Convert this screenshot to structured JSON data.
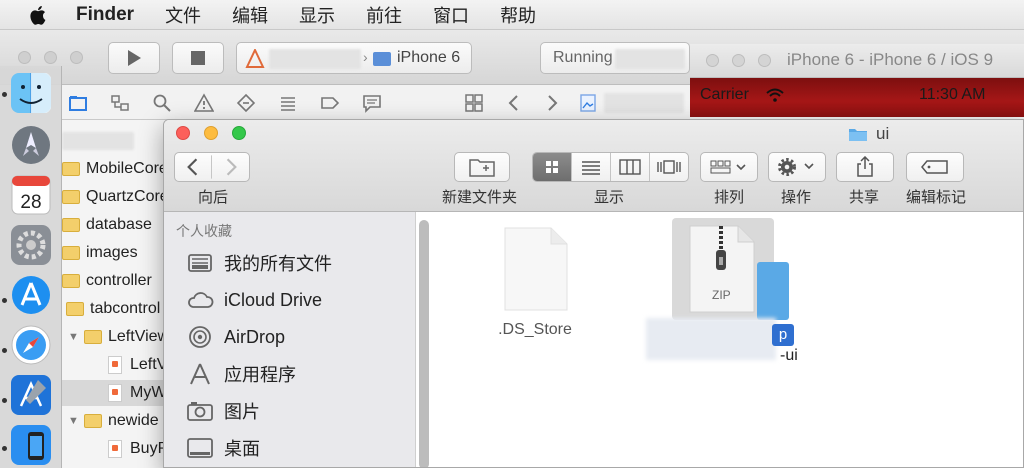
{
  "menubar": {
    "app": "Finder",
    "items": [
      "文件",
      "编辑",
      "显示",
      "前往",
      "窗口",
      "帮助"
    ]
  },
  "xcode": {
    "scheme_device": "iPhone 6",
    "status": "Running",
    "tree": [
      {
        "label": "MobileCoreS",
        "kind": "folder"
      },
      {
        "label": "QuartzCore.f",
        "kind": "folder"
      },
      {
        "label": "database",
        "kind": "folder"
      },
      {
        "label": "images",
        "kind": "folder"
      },
      {
        "label": "controller",
        "kind": "folder"
      },
      {
        "label": "tabcontrol",
        "kind": "folder"
      },
      {
        "label": "LeftView",
        "kind": "folder"
      },
      {
        "label": "LeftV",
        "kind": "swift"
      },
      {
        "label": "MyW",
        "kind": "swift"
      },
      {
        "label": "newide",
        "kind": "folder"
      },
      {
        "label": "BuyP",
        "kind": "swift"
      }
    ]
  },
  "simulator": {
    "title": "iPhone 6 - iPhone 6 / iOS 9",
    "carrier": "Carrier",
    "time": "11:30 AM"
  },
  "finder": {
    "title": "ui",
    "toolbar": {
      "back_label": "向后",
      "new_folder_label": "新建文件夹",
      "view_label": "显示",
      "arrange_label": "排列",
      "action_label": "操作",
      "share_label": "共享",
      "tags_label": "编辑标记"
    },
    "sidebar": {
      "heading": "个人收藏",
      "items": [
        "我的所有文件",
        "iCloud Drive",
        "AirDrop",
        "应用程序",
        "图片",
        "桌面"
      ]
    },
    "files": {
      "ds_store": ".DS_Store",
      "zip_tag": "ZIP",
      "zip_name_tail": "-ui",
      "badge": "p"
    }
  },
  "colors": {
    "finder_accent": "#5aa9e6",
    "sim_status_bar": "#a61717",
    "traffic_red": "#fc605b",
    "traffic_yellow": "#fdbc40",
    "traffic_green": "#34c84a"
  }
}
